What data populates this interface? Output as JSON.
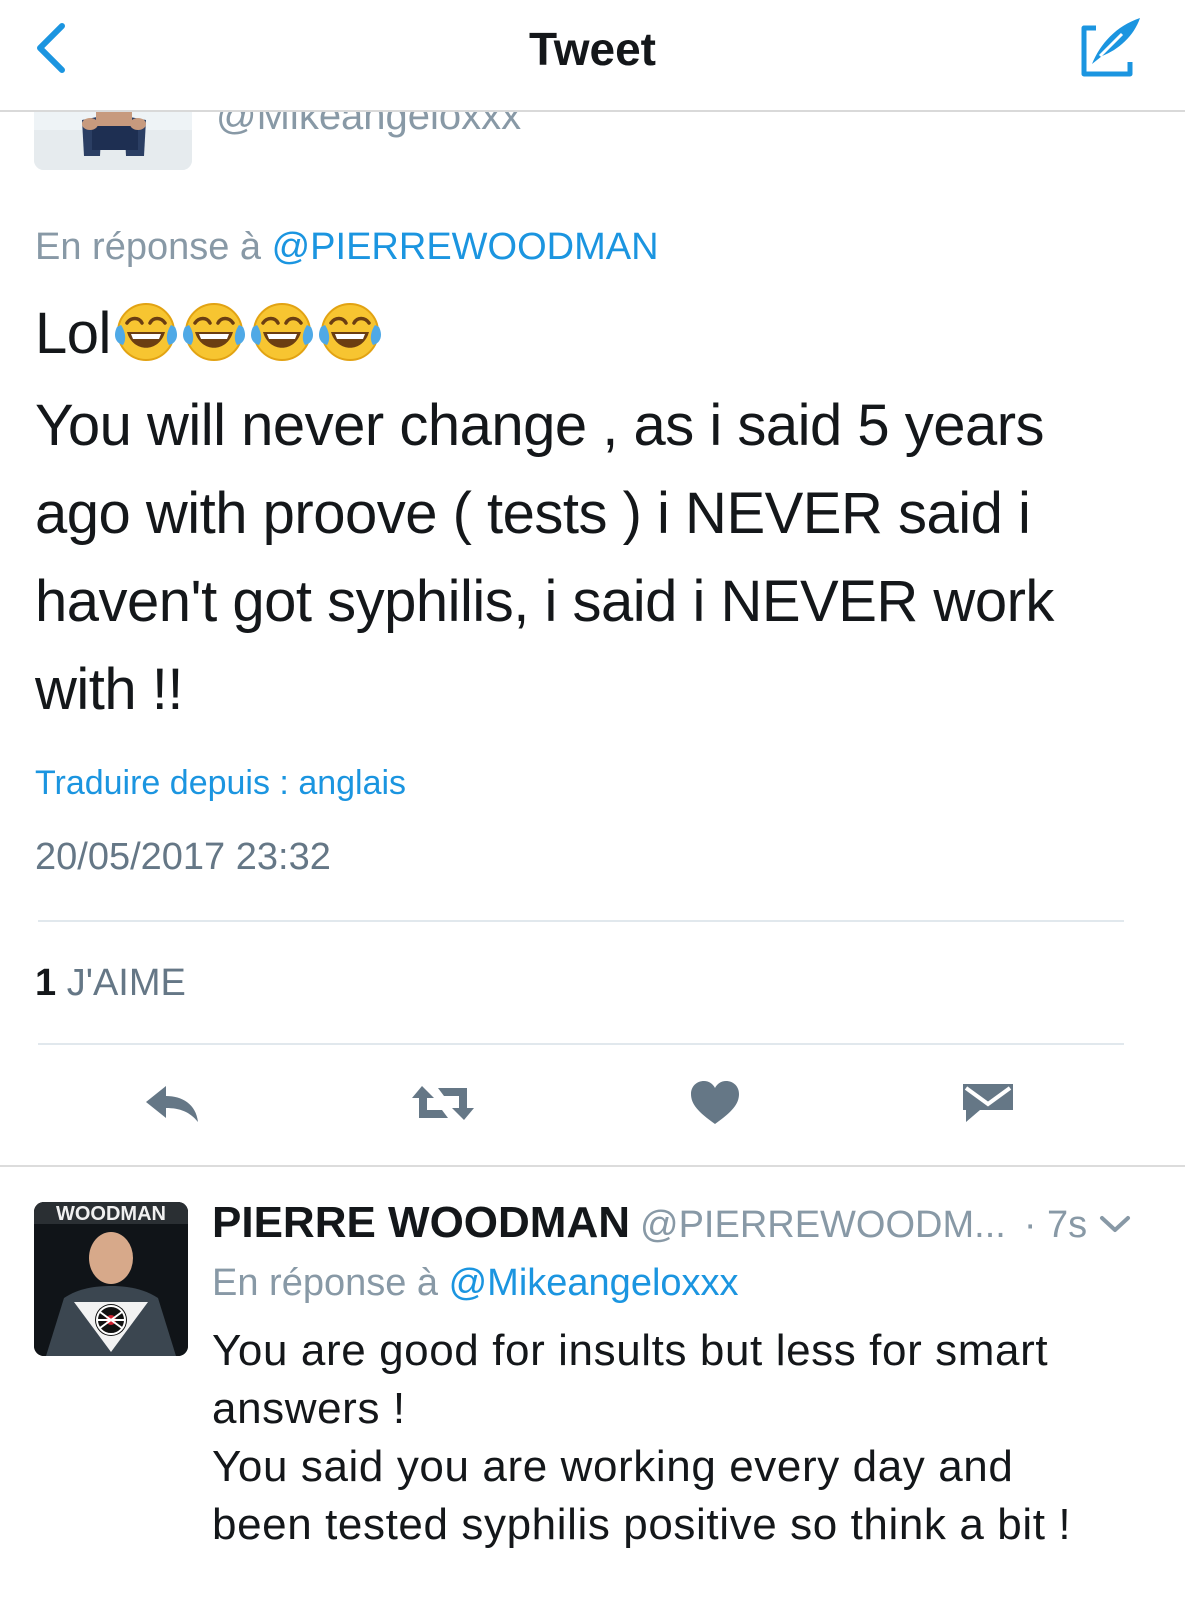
{
  "nav": {
    "title": "Tweet"
  },
  "prev_author": {
    "handle": "@Mikeangeloxxx"
  },
  "tweet": {
    "reply_prefix": "En réponse à ",
    "reply_mention": "@PIERREWOODMAN",
    "first_line_text": "Lol",
    "emoji": "face-with-tears-of-joy",
    "emoji_count": 4,
    "lines": [
      "You will never change , as i said 5 years",
      "ago with proove ( tests ) i NEVER said i",
      "haven't got syphilis, i said i NEVER work",
      "with !!"
    ],
    "translate": "Traduire depuis : anglais",
    "timestamp": "20/05/2017 23:32",
    "likes_count": "1",
    "likes_label": "J'AIME"
  },
  "actions": [
    "reply-icon",
    "retweet-icon",
    "heart-icon",
    "direct-message-icon"
  ],
  "reply": {
    "avatar_text": "WOODMAN",
    "name": "PIERRE WOODMAN",
    "handle": "@PIERREWOODM...",
    "time": "· 7s",
    "reply_prefix": "En réponse à ",
    "reply_mention": "@Mikeangeloxxx",
    "lines": [
      "You are good for insults but less for smart",
      "answers !",
      "You said you are working every day and",
      "been tested syphilis positive so think a bit !"
    ]
  },
  "colors": {
    "accent": "#1b95e0",
    "muted": "#8899a6",
    "icon": "#657786"
  }
}
